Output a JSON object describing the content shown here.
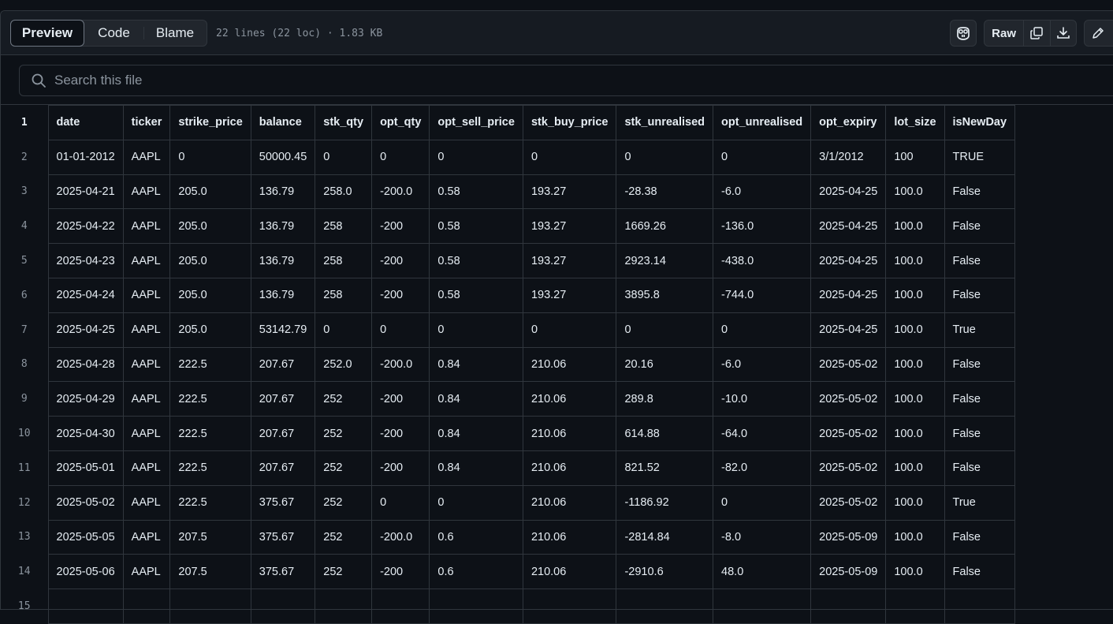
{
  "view_tabs": [
    "Preview",
    "Code",
    "Blame"
  ],
  "active_tab": "Preview",
  "file_meta": "22 lines (22 loc) · 1.83 KB",
  "toolbar": {
    "copilot_icon": "copilot-icon",
    "raw_label": "Raw",
    "copy_icon": "copy-icon",
    "download_icon": "download-icon",
    "edit_icon": "pencil-icon"
  },
  "search": {
    "placeholder": "Search this file"
  },
  "table": {
    "header_line": "1",
    "columns": [
      "date",
      "ticker",
      "strike_price",
      "balance",
      "stk_qty",
      "opt_qty",
      "opt_sell_price",
      "stk_buy_price",
      "stk_unrealised",
      "opt_unrealised",
      "opt_expiry",
      "lot_size",
      "isNewDay"
    ],
    "rows": [
      {
        "line": "2",
        "cells": [
          "01-01-2012",
          "AAPL",
          "0",
          "50000.45",
          "0",
          "0",
          "0",
          "0",
          "0",
          "0",
          "3/1/2012",
          "100",
          "TRUE"
        ]
      },
      {
        "line": "3",
        "cells": [
          "2025-04-21",
          "AAPL",
          "205.0",
          "136.79",
          "258.0",
          "-200.0",
          "0.58",
          "193.27",
          "-28.38",
          "-6.0",
          "2025-04-25",
          "100.0",
          "False"
        ]
      },
      {
        "line": "4",
        "cells": [
          "2025-04-22",
          "AAPL",
          "205.0",
          "136.79",
          "258",
          "-200",
          "0.58",
          "193.27",
          "1669.26",
          "-136.0",
          "2025-04-25",
          "100.0",
          "False"
        ]
      },
      {
        "line": "5",
        "cells": [
          "2025-04-23",
          "AAPL",
          "205.0",
          "136.79",
          "258",
          "-200",
          "0.58",
          "193.27",
          "2923.14",
          "-438.0",
          "2025-04-25",
          "100.0",
          "False"
        ]
      },
      {
        "line": "6",
        "cells": [
          "2025-04-24",
          "AAPL",
          "205.0",
          "136.79",
          "258",
          "-200",
          "0.58",
          "193.27",
          "3895.8",
          "-744.0",
          "2025-04-25",
          "100.0",
          "False"
        ]
      },
      {
        "line": "7",
        "cells": [
          "2025-04-25",
          "AAPL",
          "205.0",
          "53142.79",
          "0",
          "0",
          "0",
          "0",
          "0",
          "0",
          "2025-04-25",
          "100.0",
          "True"
        ]
      },
      {
        "line": "8",
        "cells": [
          "2025-04-28",
          "AAPL",
          "222.5",
          "207.67",
          "252.0",
          "-200.0",
          "0.84",
          "210.06",
          "20.16",
          "-6.0",
          "2025-05-02",
          "100.0",
          "False"
        ]
      },
      {
        "line": "9",
        "cells": [
          "2025-04-29",
          "AAPL",
          "222.5",
          "207.67",
          "252",
          "-200",
          "0.84",
          "210.06",
          "289.8",
          "-10.0",
          "2025-05-02",
          "100.0",
          "False"
        ]
      },
      {
        "line": "10",
        "cells": [
          "2025-04-30",
          "AAPL",
          "222.5",
          "207.67",
          "252",
          "-200",
          "0.84",
          "210.06",
          "614.88",
          "-64.0",
          "2025-05-02",
          "100.0",
          "False"
        ]
      },
      {
        "line": "11",
        "cells": [
          "2025-05-01",
          "AAPL",
          "222.5",
          "207.67",
          "252",
          "-200",
          "0.84",
          "210.06",
          "821.52",
          "-82.0",
          "2025-05-02",
          "100.0",
          "False"
        ]
      },
      {
        "line": "12",
        "cells": [
          "2025-05-02",
          "AAPL",
          "222.5",
          "375.67",
          "252",
          "0",
          "0",
          "210.06",
          "-1186.92",
          "0",
          "2025-05-02",
          "100.0",
          "True"
        ]
      },
      {
        "line": "13",
        "cells": [
          "2025-05-05",
          "AAPL",
          "207.5",
          "375.67",
          "252",
          "-200.0",
          "0.6",
          "210.06",
          "-2814.84",
          "-8.0",
          "2025-05-09",
          "100.0",
          "False"
        ]
      },
      {
        "line": "14",
        "cells": [
          "2025-05-06",
          "AAPL",
          "207.5",
          "375.67",
          "252",
          "-200",
          "0.6",
          "210.06",
          "-2910.6",
          "48.0",
          "2025-05-09",
          "100.0",
          "False"
        ]
      },
      {
        "line": "15",
        "cells": [
          "",
          "",
          "",
          "",
          "",
          "",
          "",
          "",
          "",
          "",
          "",
          "",
          ""
        ]
      }
    ]
  }
}
